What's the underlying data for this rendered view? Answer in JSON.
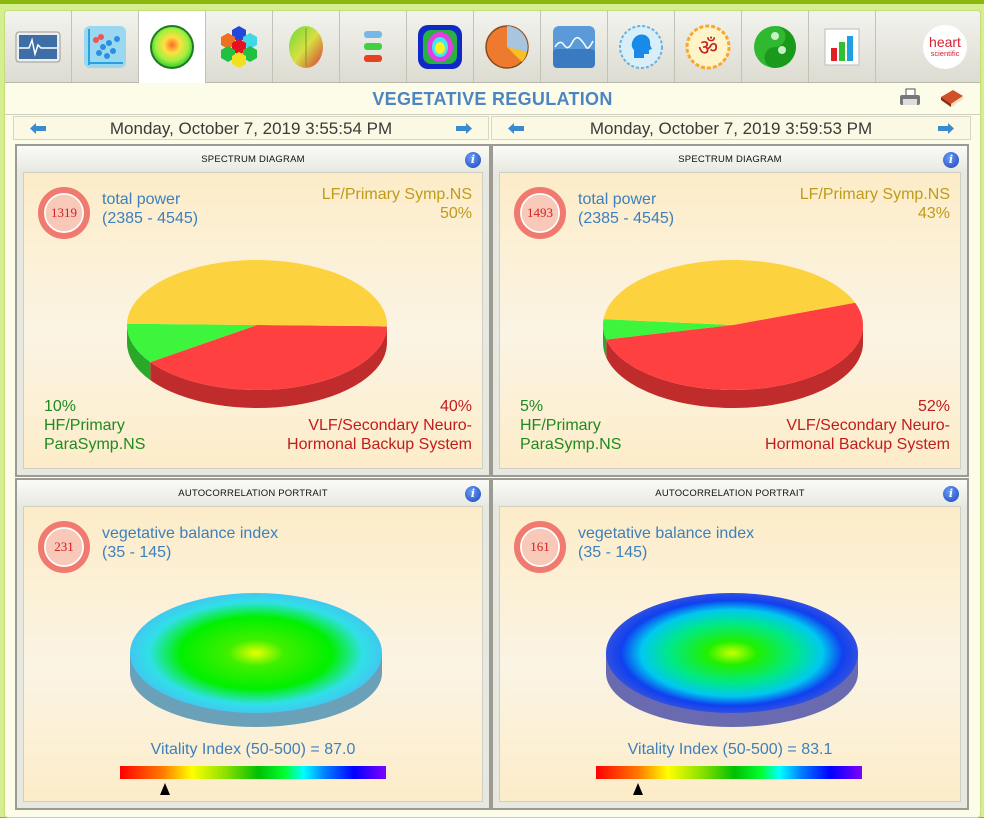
{
  "tabs": [
    {
      "name": "ecg-monitor-icon",
      "active": false
    },
    {
      "name": "scatter-plot-icon",
      "active": false
    },
    {
      "name": "vegetative-regulation-icon",
      "active": true
    },
    {
      "name": "hexagon-chakra-icon",
      "active": false
    },
    {
      "name": "brain-map-icon",
      "active": false
    },
    {
      "name": "spine-icon",
      "active": false
    },
    {
      "name": "symmetry-pattern-icon",
      "active": false
    },
    {
      "name": "pie-chart-icon",
      "active": false
    },
    {
      "name": "wave-graph-icon",
      "active": false
    },
    {
      "name": "head-profile-icon",
      "active": false
    },
    {
      "name": "om-symbol-icon",
      "active": false
    },
    {
      "name": "yin-yang-icon",
      "active": false
    },
    {
      "name": "bar-chart-icon",
      "active": false
    }
  ],
  "brand": {
    "line1": "heart",
    "line2": "scientific"
  },
  "page_title": "VEGETATIVE REGULATION",
  "toolbar": {
    "print_icon": "printer-icon",
    "help_icon": "book-icon"
  },
  "colors": {
    "accent": "#4d85c3",
    "lf": "#c09a1a",
    "hf": "#1f8a1f",
    "vlf": "#c01d1d",
    "pie_lf": "#fcd23f",
    "pie_hf": "#3cf53c",
    "pie_vlf": "#ff4040"
  },
  "sessions": [
    {
      "datetime": "Monday, October 7, 2019 3:55:54 PM",
      "spectrum": {
        "title": "SPECTRUM DIAGRAM",
        "info": "i",
        "total_power_label": "total power",
        "total_power_range": "(2385 - 4545)",
        "total_power_value": "1319",
        "lf_label": "LF/Primary Symp.NS",
        "lf_pct": "50%",
        "hf_pct": "10%",
        "hf_label_1": "HF/Primary",
        "hf_label_2": "ParaSymp.NS",
        "vlf_pct": "40%",
        "vlf_label_1": "VLF/Secondary Neuro-",
        "vlf_label_2": "Hormonal Backup System"
      },
      "autocorrelation": {
        "title": "AUTOCORRELATION PORTRAIT",
        "info": "i",
        "index_label": "vegetative balance index",
        "index_range": "(35 - 145)",
        "index_value": "231",
        "vitality_text": "Vitality Index (50-500) = 87.0",
        "vitality_value": 87.0,
        "vitality_min": 50,
        "vitality_max": 500
      }
    },
    {
      "datetime": "Monday, October 7, 2019 3:59:53 PM",
      "spectrum": {
        "title": "SPECTRUM DIAGRAM",
        "info": "i",
        "total_power_label": "total power",
        "total_power_range": "(2385 - 4545)",
        "total_power_value": "1493",
        "lf_label": "LF/Primary Symp.NS",
        "lf_pct": "43%",
        "hf_pct": "5%",
        "hf_label_1": "HF/Primary",
        "hf_label_2": "ParaSymp.NS",
        "vlf_pct": "52%",
        "vlf_label_1": "VLF/Secondary Neuro-",
        "vlf_label_2": "Hormonal Backup System"
      },
      "autocorrelation": {
        "title": "AUTOCORRELATION PORTRAIT",
        "info": "i",
        "index_label": "vegetative balance index",
        "index_range": "(35 - 145)",
        "index_value": "161",
        "vitality_text": "Vitality Index (50-500) = 83.1",
        "vitality_value": 83.1,
        "vitality_min": 50,
        "vitality_max": 500
      }
    }
  ],
  "chart_data": [
    {
      "type": "pie",
      "title": "SPECTRUM DIAGRAM",
      "categories": [
        "LF/Primary Symp.NS",
        "HF/Primary ParaSymp.NS",
        "VLF/Secondary Neuro-Hormonal Backup System"
      ],
      "values": [
        50,
        10,
        40
      ]
    },
    {
      "type": "pie",
      "title": "SPECTRUM DIAGRAM",
      "categories": [
        "LF/Primary Symp.NS",
        "HF/Primary ParaSymp.NS",
        "VLF/Secondary Neuro-Hormonal Backup System"
      ],
      "values": [
        43,
        5,
        52
      ]
    }
  ]
}
